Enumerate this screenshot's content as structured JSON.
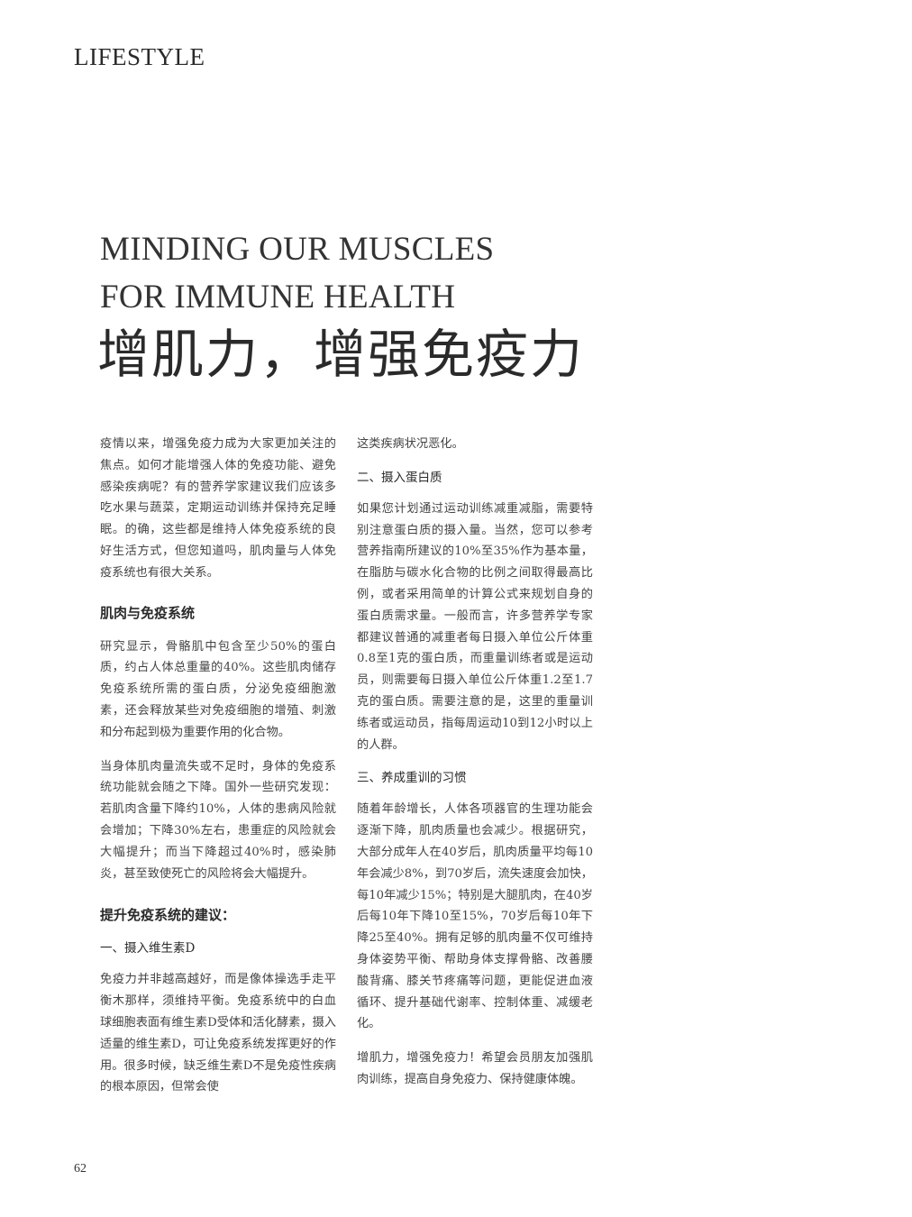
{
  "section": "LIFESTYLE",
  "title_en": [
    "MINDING OUR MUSCLES",
    "FOR IMMUNE HEALTH"
  ],
  "title_cn": "增肌力，增强免疫力",
  "left_column": {
    "intro": "疫情以来，增强免疫力成为大家更加关注的焦点。如何才能增强人体的免疫功能、避免感染疾病呢？有的营养学家建议我们应该多吃水果与蔬菜，定期运动训练并保持充足睡眠。的确，这些都是维持人体免疫系统的良好生活方式，但您知道吗，肌肉量与人体免疫系统也有很大关系。",
    "h_muscle": "肌肉与免疫系统",
    "p_muscle_1": "研究显示，骨骼肌中包含至少50%的蛋白质，约占人体总重量的40%。这些肌肉储存免疫系统所需的蛋白质，分泌免疫细胞激素，还会释放某些对免疫细胞的增殖、刺激和分布起到极为重要作用的化合物。",
    "p_muscle_2": "当身体肌肉量流失或不足时，身体的免疫系统功能就会随之下降。国外一些研究发现：若肌肉含量下降约10%，人体的患病风险就会增加；下降30%左右，患重症的风险就会大幅提升；而当下降超过40%时，感染肺炎，甚至致使死亡的风险将会大幅提升。",
    "h_advice": "提升免疫系统的建议：",
    "h_vitd": "一、摄入维生素D",
    "p_vitd": "免疫力并非越高越好，而是像体操选手走平衡木那样，须维持平衡。免疫系统中的白血球细胞表面有维生素D受体和活化酵素，摄入适量的维生素D，可让免疫系统发挥更好的作用。很多时候，缺乏维生素D不是免疫性疾病的根本原因，但常会使"
  },
  "right_column": {
    "p_cont": "这类疾病状况恶化。",
    "h_protein": "二、摄入蛋白质",
    "p_protein": "如果您计划通过运动训练减重减脂，需要特别注意蛋白质的摄入量。当然，您可以参考营养指南所建议的10%至35%作为基本量，在脂肪与碳水化合物的比例之间取得最高比例，或者采用简单的计算公式来规划自身的蛋白质需求量。一般而言，许多营养学专家都建议普通的减重者每日摄入单位公斤体重0.8至1克的蛋白质，而重量训练者或是运动员，则需要每日摄入单位公斤体重1.2至1.7克的蛋白质。需要注意的是，这里的重量训练者或运动员，指每周运动10到12小时以上的人群。",
    "h_habit": "三、养成重训的习惯",
    "p_habit": "随着年龄增长，人体各项器官的生理功能会逐渐下降，肌肉质量也会减少。根据研究，大部分成年人在40岁后，肌肉质量平均每10年会减少8%，到70岁后，流失速度会加快，每10年减少15%；特别是大腿肌肉，在40岁后每10年下降10至15%，70岁后每10年下降25至40%。拥有足够的肌肉量不仅可维持身体姿势平衡、帮助身体支撑骨骼、改善腰酸背痛、膝关节疼痛等问题，更能促进血液循环、提升基础代谢率、控制体重、减缓老化。",
    "p_closing": "增肌力，增强免疫力！希望会员朋友加强肌肉训练，提高自身免疫力、保持健康体魄。"
  },
  "page_number": "62"
}
